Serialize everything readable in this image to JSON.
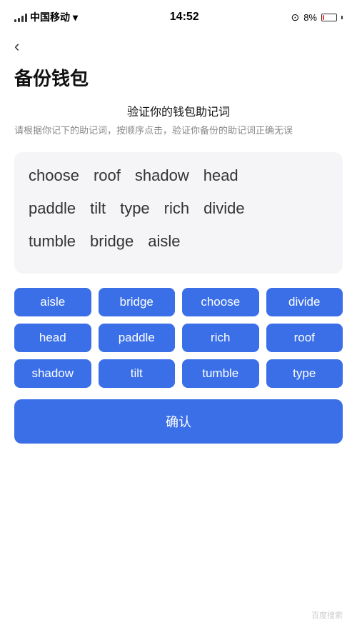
{
  "statusBar": {
    "carrier": "中国移动",
    "time": "14:52",
    "battery": "8%",
    "wifi": true
  },
  "back": "‹",
  "pageTitle": "备份钱包",
  "subtitle": {
    "main": "验证你的钱包助记词",
    "desc": "请根据你记下的助记词，按顺序点击，验证你备份的助记词正确无误"
  },
  "wordBox": {
    "rows": [
      [
        "choose",
        "roof",
        "shadow",
        "head"
      ],
      [
        "paddle",
        "tilt",
        "type",
        "rich",
        "divide"
      ],
      [
        "tumble",
        "bridge",
        "aisle"
      ]
    ]
  },
  "chips": [
    "aisle",
    "bridge",
    "choose",
    "divide",
    "head",
    "paddle",
    "rich",
    "roof",
    "shadow",
    "tilt",
    "tumble",
    "type"
  ],
  "confirmBtn": "确认"
}
